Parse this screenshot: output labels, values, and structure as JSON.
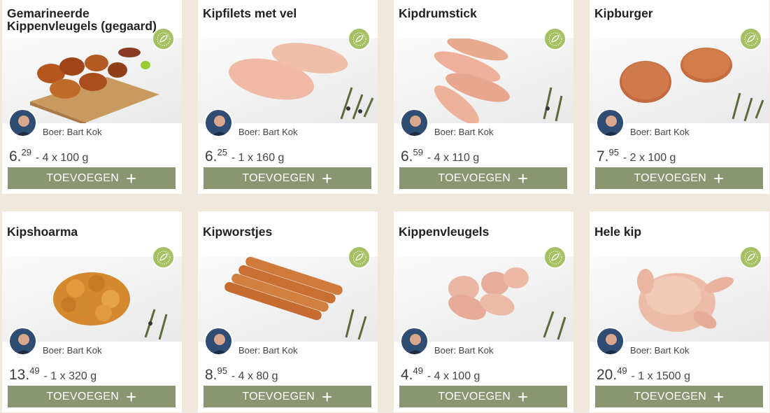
{
  "products": [
    {
      "name": "Gemarineerde Kippenvleugels (gegaard)",
      "farmer": "Boer: Bart Kok",
      "price_main": "6.",
      "price_cents": "29",
      "quantity": "- 4 x 100 g",
      "button_label": "TOEVOEGEN",
      "product_icon": "marinated-wings"
    },
    {
      "name": "Kipfilets met vel",
      "farmer": "Boer: Bart Kok",
      "price_main": "6.",
      "price_cents": "25",
      "quantity": "- 1 x 160 g",
      "button_label": "TOEVOEGEN",
      "product_icon": "chicken-fillets"
    },
    {
      "name": "Kipdrumstick",
      "farmer": "Boer: Bart Kok",
      "price_main": "6.",
      "price_cents": "59",
      "quantity": "- 4 x 110 g",
      "button_label": "TOEVOEGEN",
      "product_icon": "drumsticks"
    },
    {
      "name": "Kipburger",
      "farmer": "Boer: Bart Kok",
      "price_main": "7.",
      "price_cents": "95",
      "quantity": "- 2 x 100 g",
      "button_label": "TOEVOEGEN",
      "product_icon": "burgers"
    },
    {
      "name": "Kipshoarma",
      "farmer": "Boer: Bart Kok",
      "price_main": "13.",
      "price_cents": "49",
      "quantity": "- 1 x 320 g",
      "button_label": "TOEVOEGEN",
      "product_icon": "shoarma"
    },
    {
      "name": "Kipworstjes",
      "farmer": "Boer: Bart Kok",
      "price_main": "8.",
      "price_cents": "95",
      "quantity": "- 4 x 80 g",
      "button_label": "TOEVOEGEN",
      "product_icon": "sausages"
    },
    {
      "name": "Kippenvleugels",
      "farmer": "Boer: Bart Kok",
      "price_main": "4.",
      "price_cents": "49",
      "quantity": "- 4 x 100 g",
      "button_label": "TOEVOEGEN",
      "product_icon": "raw-wings"
    },
    {
      "name": "Hele kip",
      "farmer": "Boer: Bart Kok",
      "price_main": "20.",
      "price_cents": "49",
      "quantity": "- 1 x 1500 g",
      "button_label": "TOEVOEGEN",
      "product_icon": "whole-chicken"
    }
  ],
  "colors": {
    "background": "#efe9dc",
    "button": "#8a9572",
    "organic_badge": "#a7c064",
    "avatar": "#2f4d72"
  }
}
